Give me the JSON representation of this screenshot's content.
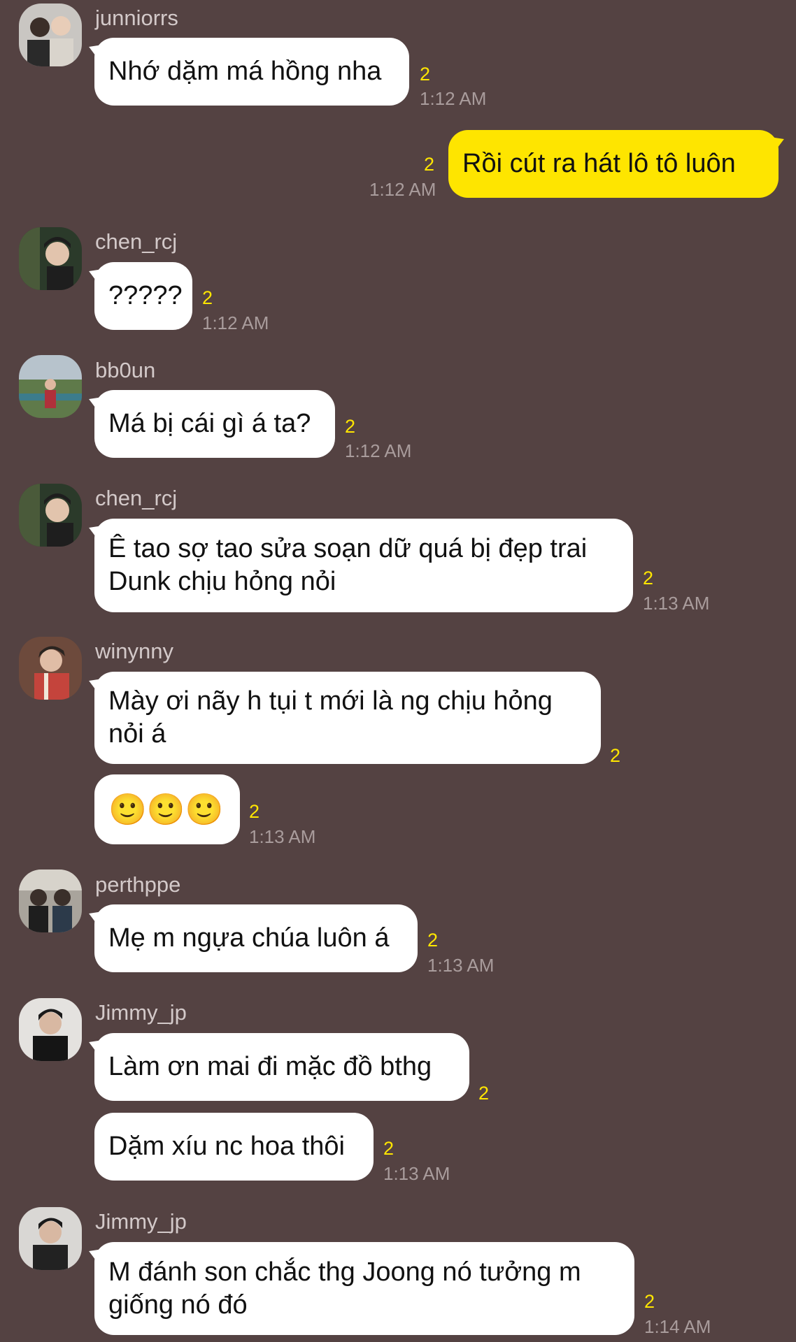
{
  "colors": {
    "background": "#544242",
    "incoming_bubble": "#ffffff",
    "outgoing_bubble": "#fee500",
    "unread_count": "#ffe600",
    "timestamp": "#a99c9c",
    "username": "#d3c9c9"
  },
  "messages": [
    {
      "sender": "junniorrs",
      "text": "Nhớ dặm má hồng nha",
      "unread": "2",
      "time": "1:12 AM"
    },
    {
      "sender": "me",
      "text": "Rồi cút ra hát lô tô luôn",
      "unread": "2",
      "time": "1:12 AM"
    },
    {
      "sender": "chen_rcj",
      "text": "?????",
      "unread": "2",
      "time": "1:12 AM"
    },
    {
      "sender": "bb0un",
      "text": "Má bị cái gì á ta?",
      "unread": "2",
      "time": "1:12 AM"
    },
    {
      "sender": "chen_rcj",
      "text": "Ê tao sợ tao sửa soạn dữ quá bị đẹp trai\nDunk chịu hỏng nỏi",
      "unread": "2",
      "time": "1:13 AM"
    },
    {
      "sender": "winynny",
      "text": "Mày ơi nãy h tụi t mới là ng chịu hỏng\nnỏi á",
      "unread": "2",
      "time": ""
    },
    {
      "sender": "winynny",
      "text": "🙂🙂🙂",
      "unread": "2",
      "time": "1:13 AM"
    },
    {
      "sender": "perthppe",
      "text": "Mẹ m ngựa chúa luôn á",
      "unread": "2",
      "time": "1:13 AM"
    },
    {
      "sender": "Jimmy_jp",
      "text": "Làm ơn mai đi mặc đồ bthg",
      "unread": "2",
      "time": ""
    },
    {
      "sender": "Jimmy_jp",
      "text": "Dặm xíu nc hoa thôi",
      "unread": "2",
      "time": "1:13 AM"
    },
    {
      "sender": "Jimmy_jp",
      "text": "M đánh son chắc thg Joong nó tưởng m\ngiống nó đó",
      "unread": "2",
      "time": "1:14 AM"
    }
  ]
}
